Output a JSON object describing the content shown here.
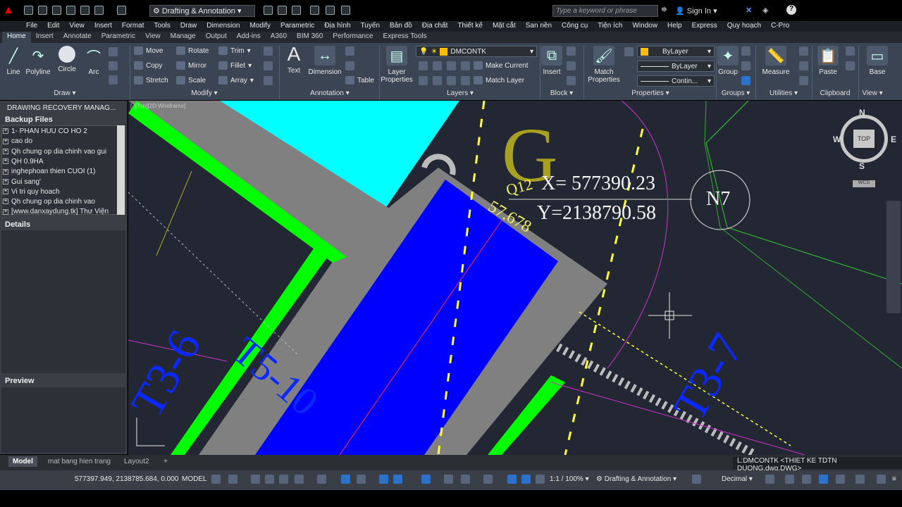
{
  "quick_access": {
    "workspace": "Drafting & Annotation",
    "search_placeholder": "Type a keyword or phrase",
    "sign_in": "Sign In"
  },
  "menu": [
    "File",
    "Edit",
    "View",
    "Insert",
    "Format",
    "Tools",
    "Draw",
    "Dimension",
    "Modify",
    "Parametric",
    "Địa hình",
    "Tuyến",
    "Bản đồ",
    "Địa chất",
    "Thiết kế",
    "Mặt cắt",
    "San nền",
    "Công cụ",
    "Tiện ích",
    "Window",
    "Help",
    "Express",
    "Quy hoạch",
    "C-Pro"
  ],
  "tabs": [
    "Home",
    "Insert",
    "Annotate",
    "Parametric",
    "View",
    "Manage",
    "Output",
    "Add-ins",
    "A360",
    "BIM 360",
    "Performance",
    "Express Tools"
  ],
  "ribbon": {
    "draw": {
      "title": "Draw",
      "line": "Line",
      "polyline": "Polyline",
      "circle": "Circle",
      "arc": "Arc"
    },
    "modify": {
      "title": "Modify",
      "move": "Move",
      "rotate": "Rotate",
      "trim": "Trim",
      "copy": "Copy",
      "mirror": "Mirror",
      "fillet": "Fillet",
      "stretch": "Stretch",
      "scale": "Scale",
      "array": "Array"
    },
    "annotation": {
      "title": "Annotation",
      "text": "Text",
      "dimension": "Dimension",
      "table": "Table"
    },
    "layers": {
      "title": "Layers",
      "layer_properties_1": "Layer",
      "layer_properties_2": "Properties",
      "current_layer": "DMCONTK",
      "make_current": "Make Current",
      "match_layer": "Match Layer"
    },
    "block": {
      "title": "Block",
      "insert": "Insert"
    },
    "properties": {
      "title": "Properties",
      "match_1": "Match",
      "match_2": "Properties",
      "color": "ByLayer",
      "linetype": "ByLayer",
      "lineweight": "Contin..."
    },
    "groups": {
      "title": "Groups",
      "group": "Group"
    },
    "utilities": {
      "title": "Utilities",
      "measure": "Measure"
    },
    "clipboard": {
      "title": "Clipboard",
      "paste": "Paste"
    },
    "view": {
      "title": "View",
      "base": "Base"
    }
  },
  "palette": {
    "title": "DRAWING RECOVERY MANAG...",
    "backup_header": "Backup Files",
    "files": [
      "1- PHAN HUU CO  HO 2",
      "cao do",
      "Qh chung op dia chinh vao  gui",
      "QH 0.9HA",
      "inghephoan thien CUOI (1)",
      "Gui sang'",
      "Vi tri quy hoach",
      "Qh chung op dia chinh vao",
      "[www.danxaydung.tk] Thư Viện"
    ],
    "details_header": "Details",
    "preview_header": "Preview"
  },
  "viewport": {
    "label": "[-][Top][2D Wireframe]",
    "big_letter": "G",
    "coord_x": "X= 577390.23",
    "coord_y": "Y=2138790.58",
    "node": "N7",
    "label_t3_7": "T3-7",
    "label_t3_6": "T3-6",
    "label_t5_10": "T5-10",
    "yellow_678": "57.678",
    "yellow_412": "Q12",
    "compass": {
      "n": "N",
      "e": "E",
      "s": "S",
      "w": "W",
      "top": "TOP",
      "wcs": "WCS"
    }
  },
  "layout_tabs": [
    "Model",
    "mat bang hien trang",
    "Layout2",
    "+"
  ],
  "command_line": "L:DMCONTK  <THIET KE TDTN DUONG.dwg.DWG>",
  "status": {
    "coords": "577397.949, 2138785.684, 0.000",
    "model": "MODEL",
    "scale": "1:1 / 100%",
    "workspace": "Drafting & Annotation",
    "units": "Decimal"
  },
  "colors": {
    "cyan": "#00ffff",
    "green": "#00ff00",
    "gray": "#808080",
    "blue": "#0000ff",
    "yellow_dash": "#ffff33",
    "canvas": "#232733"
  }
}
